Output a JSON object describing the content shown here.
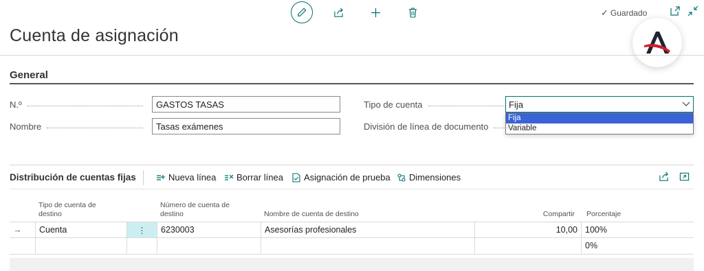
{
  "toolbar": {
    "edit_icon": "pencil-icon",
    "share_icon": "share-icon",
    "new_icon": "plus-icon",
    "delete_icon": "trash-icon",
    "saved_label": "Guardado",
    "accent": "#00716c"
  },
  "page": {
    "title": "Cuenta de asignación"
  },
  "general": {
    "section_title": "General",
    "no_label": "N.º",
    "no_value": "GASTOS TASAS",
    "name_label": "Nombre",
    "name_value": "Tasas exámenes",
    "account_type_label": "Tipo de cuenta",
    "account_type_value": "Fija",
    "account_type_options": [
      "Fija",
      "Variable"
    ],
    "split_label": "División de línea de documento"
  },
  "subpage": {
    "title": "Distribución de cuentas fijas",
    "actions": {
      "new_line": "Nueva línea",
      "delete_line": "Borrar línea",
      "test_allocation": "Asignación de prueba",
      "dimensions": "Dimensiones"
    },
    "columns": {
      "dest_type": "Tipo de cuenta de destino",
      "dest_no": "Número de cuenta de destino",
      "dest_name": "Nombre de cuenta de destino",
      "share": "Compartir",
      "percentage": "Porcentaje"
    },
    "rows": [
      {
        "arrow": "→",
        "dest_type": "Cuenta",
        "dest_no": "6230003",
        "dest_name": "Asesorías profesionales",
        "share": "10,00",
        "percentage": "100%"
      },
      {
        "arrow": "",
        "dest_type": "",
        "dest_no": "",
        "dest_name": "",
        "share": "",
        "percentage": "0%"
      }
    ]
  }
}
